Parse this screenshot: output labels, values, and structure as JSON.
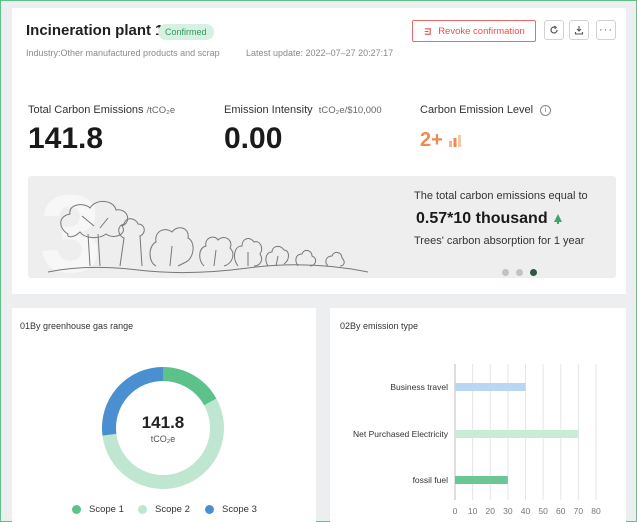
{
  "header": {
    "title": "Incineration plant 1",
    "badge": "Confirmed",
    "industry": "Industry:Other manufactured products and scrap",
    "latest_update": "Latest update: 2022–07–27 20:27:17",
    "revoke_label": "Revoke confirmation",
    "icons": [
      "refresh-icon",
      "download-icon",
      "more-icon"
    ]
  },
  "stats": {
    "total": {
      "label": "Total Carbon Emissions",
      "unit": "/tCO₂e",
      "value": "141.8"
    },
    "intensity": {
      "label": "Emission Intensity",
      "unit": "tCO₂e/$10,000",
      "value": "0.00"
    },
    "level": {
      "label": "Carbon Emission Level",
      "value": "2+",
      "color": "#ef8a52"
    }
  },
  "banner": {
    "line1": "The total carbon emissions equal to",
    "value": "0.57*10 thousand",
    "line2": "Trees' carbon absorption for 1 year",
    "page_count": 3,
    "active_page": 3
  },
  "ghg_panel": {
    "title": "01By greenhouse gas range",
    "center_value": "141.8",
    "center_unit": "tCO₂e",
    "chart_data": {
      "type": "pie",
      "labels": [
        "Scope 1",
        "Scope 2",
        "Scope 3"
      ],
      "values": [
        17,
        56,
        27
      ],
      "colors": [
        "#5cc28a",
        "#bfe6d0",
        "#4a8fd0"
      ],
      "legend": "bottom"
    }
  },
  "type_panel": {
    "title": "02By emission type",
    "chart_data": {
      "type": "bar",
      "orientation": "horizontal",
      "categories": [
        "Business travel",
        "Net Purchased Electricity",
        "fossil fuel"
      ],
      "values": [
        40,
        70,
        30
      ],
      "colors": [
        "#b7d7f3",
        "#c9ecd7",
        "#6bc896"
      ],
      "xlim": [
        0,
        80
      ],
      "xticks": [
        "0",
        "10",
        "20",
        "30",
        "40",
        "50",
        "60",
        "70",
        "80"
      ],
      "grid": true
    }
  }
}
